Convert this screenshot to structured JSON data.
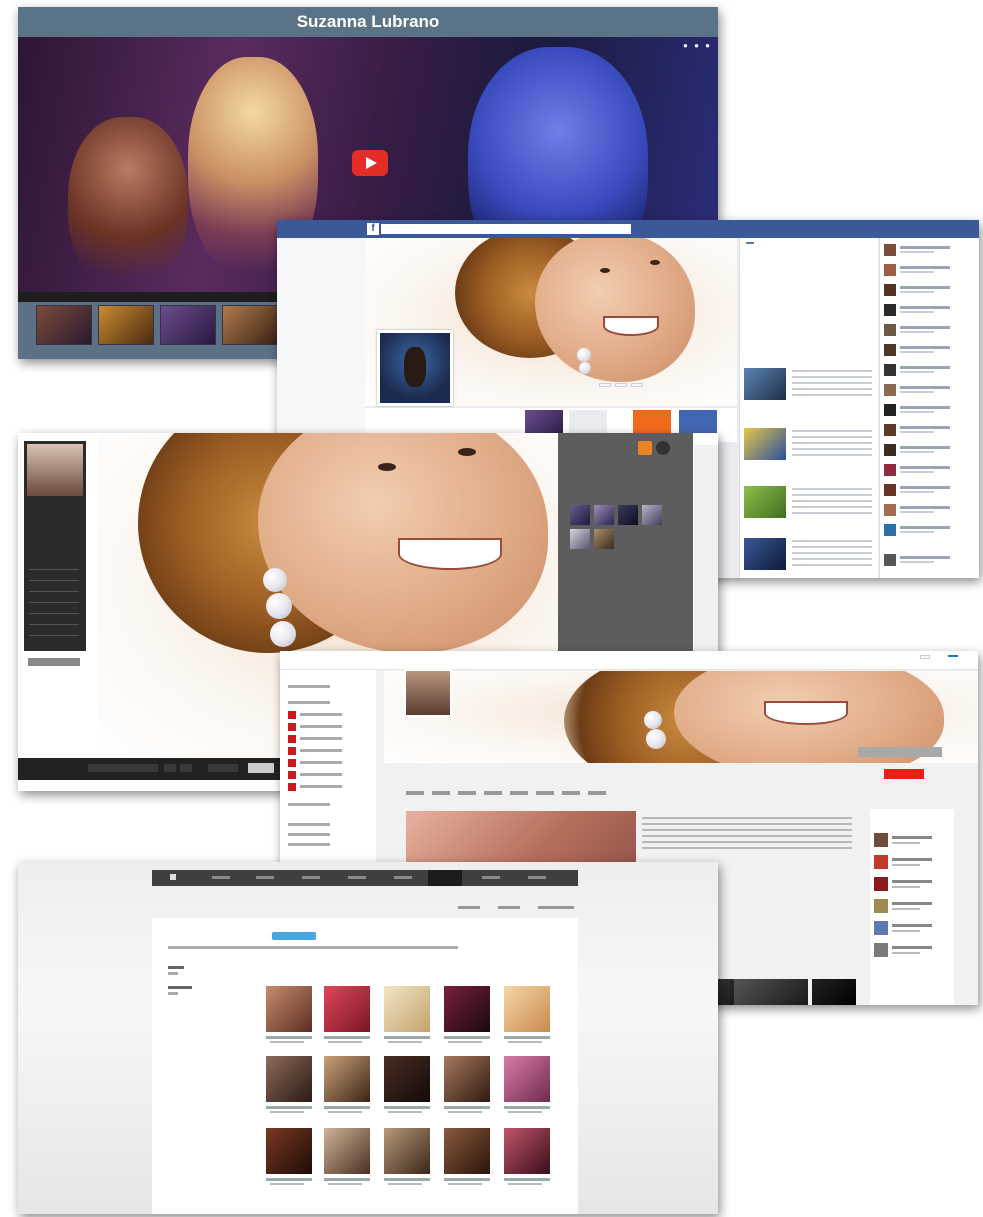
{
  "panel_video": {
    "title": "Suzanna Lubrano"
  },
  "colors": {
    "video_titlebar": "#5b7386",
    "facebook_blue": "#3b5998",
    "youtube_red": "#e62117",
    "youtube_blue": "#167ac6",
    "photo_sidebar": "#2b2b2b",
    "album_badge": "#45a6e0"
  },
  "icons": [
    "play-button-icon",
    "facebook-logo-icon",
    "rss-icon",
    "gear-icon",
    "youtube-logo-icon",
    "home-icon"
  ]
}
